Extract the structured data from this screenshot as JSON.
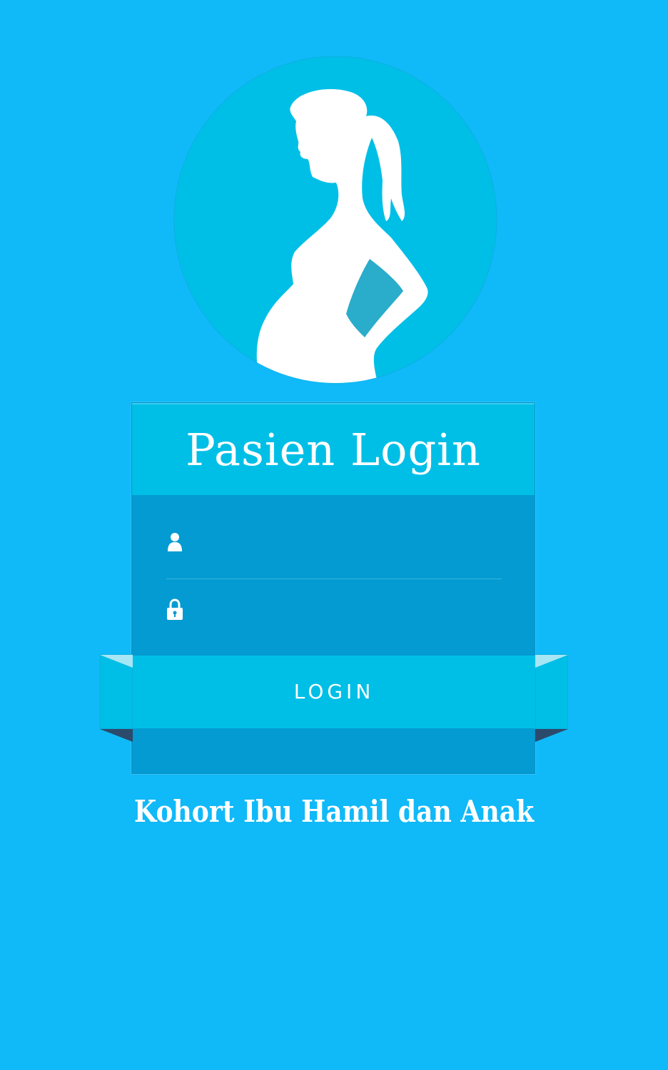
{
  "header": {
    "title": "Pasien Login"
  },
  "form": {
    "username": {
      "value": "",
      "placeholder": "",
      "icon": "user-icon"
    },
    "password": {
      "value": "",
      "placeholder": "",
      "icon": "lock-icon"
    },
    "login_label": "LOGIN"
  },
  "footer": {
    "app_title": "Kohort Ibu Hamil dan Anak"
  },
  "colors": {
    "background": "#10b9f8",
    "logo_circle": "#00bfe6",
    "card_header": "#00bfe6",
    "card_body": "#039bd1",
    "ribbon": "#00bfe6",
    "ribbon_fold": "#2c4a6b",
    "text": "#ffffff"
  }
}
